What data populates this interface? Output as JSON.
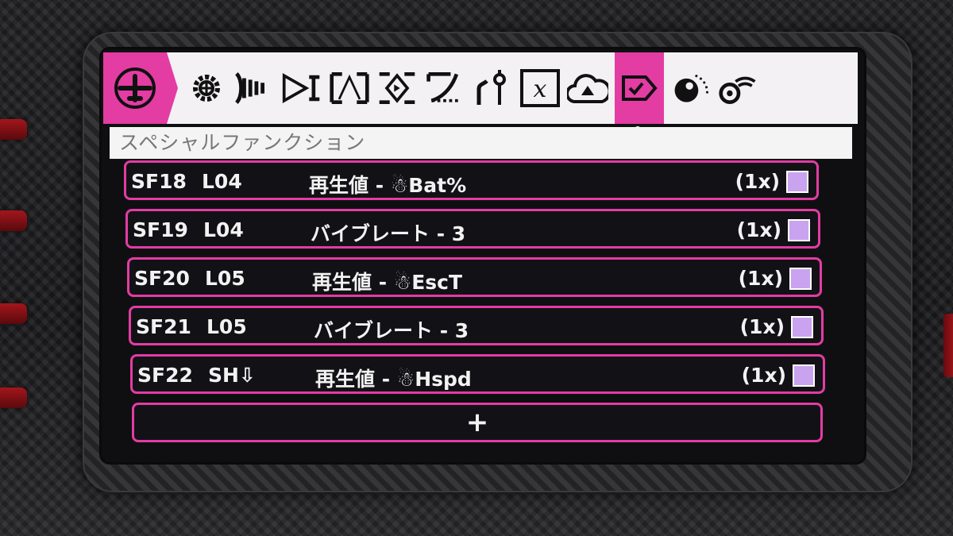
{
  "toolbar": {
    "icons": [
      "model-airplane-icon",
      "gear-icon",
      "trainer-signal-icon",
      "mixer-icon",
      "input-curve-icon",
      "output-servo-icon",
      "curve-icon",
      "logic-switch-icon",
      "global-variable-x-icon",
      "telemetry-cloud-icon",
      "special-function-check-icon",
      "sensor-eye-icon",
      "telemetry-stream-icon"
    ],
    "active": "special-function-check-icon",
    "global_var_label": "x"
  },
  "title": "スペシャルファンクション",
  "rows": [
    {
      "id": "SF18",
      "switch": "L04",
      "function": "再生値 - ☃Bat%",
      "repeat": "(1x)",
      "enabled": true
    },
    {
      "id": "SF19",
      "switch": "L04",
      "function": "バイブレート - 3",
      "repeat": "(1x)",
      "enabled": true
    },
    {
      "id": "SF20",
      "switch": "L05",
      "function": "再生値 - ☃EscT",
      "repeat": "(1x)",
      "enabled": true
    },
    {
      "id": "SF21",
      "switch": "L05",
      "function": "バイブレート - 3",
      "repeat": "(1x)",
      "enabled": true
    },
    {
      "id": "SF22",
      "switch": "SH⇩",
      "function": "再生値 - ☃Hspd",
      "repeat": "(1x)",
      "enabled": true
    }
  ],
  "add_label": "+",
  "colors": {
    "accent": "#e33ca3",
    "checkbox": "#c9a3ef",
    "row_bg": "#121216",
    "toolbar_bg": "#f3f1f4"
  }
}
